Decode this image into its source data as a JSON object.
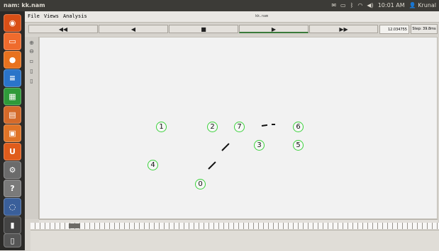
{
  "topbar": {
    "window_title": "nam: kk.nam",
    "status": {
      "mail_icon": "mail-icon",
      "battery_icon": "battery-icon",
      "bluetooth_icon": "bluetooth-icon",
      "wifi_icon": "wifi-icon",
      "volume_icon": "volume-icon",
      "time": "10:01 AM",
      "user": "Krunal"
    }
  },
  "launcher": {
    "items": [
      {
        "name": "dash-icon",
        "color": "#d94f16",
        "glyph": "◉"
      },
      {
        "name": "files-icon",
        "color": "#ef6b2d",
        "glyph": "▭"
      },
      {
        "name": "firefox-icon",
        "color": "#e8721e",
        "glyph": "●"
      },
      {
        "name": "writer-icon",
        "color": "#2a74c9",
        "glyph": "≡"
      },
      {
        "name": "calc-icon",
        "color": "#2f9a3a",
        "glyph": "▦"
      },
      {
        "name": "impress-icon",
        "color": "#d46a2a",
        "glyph": "▤"
      },
      {
        "name": "software-center-icon",
        "color": "#e07427",
        "glyph": "▣"
      },
      {
        "name": "ubuntu-one-icon",
        "color": "#e05c1c",
        "glyph": "U"
      },
      {
        "name": "settings-icon",
        "color": "#6b6b6b",
        "glyph": "⚙"
      },
      {
        "name": "help-icon",
        "color": "#7a7a7a",
        "glyph": "?"
      },
      {
        "name": "workspaces-icon",
        "color": "#3a5f9a",
        "glyph": "◌"
      },
      {
        "name": "terminal-icon",
        "color": "#444444",
        "glyph": "▮"
      },
      {
        "name": "trash-icon",
        "color": "#555555",
        "glyph": "▯"
      }
    ]
  },
  "menubar": {
    "file": "File",
    "views": "Views",
    "analysis": "Analysis",
    "filename": "kk.nam"
  },
  "controls": {
    "rewind": "◀◀",
    "back": "◀",
    "stop": "■",
    "play": "▶",
    "fastforward": "▶▶",
    "time": "12.034755",
    "step": "Step: 39.8ms"
  },
  "toolstrip": {
    "icons": [
      "zoom-in-icon",
      "zoom-out-icon",
      "fit-icon",
      "tool-a-icon",
      "tool-b-icon"
    ]
  },
  "network": {
    "nodes": [
      {
        "id": "0",
        "label": "0"
      },
      {
        "id": "1",
        "label": "1"
      },
      {
        "id": "2",
        "label": "2"
      },
      {
        "id": "3",
        "label": "3"
      },
      {
        "id": "4",
        "label": "4"
      },
      {
        "id": "5",
        "label": "5"
      },
      {
        "id": "6",
        "label": "6"
      },
      {
        "id": "7",
        "label": "7"
      }
    ],
    "node_color": "#3cd23c",
    "packet_color": "#111111"
  }
}
